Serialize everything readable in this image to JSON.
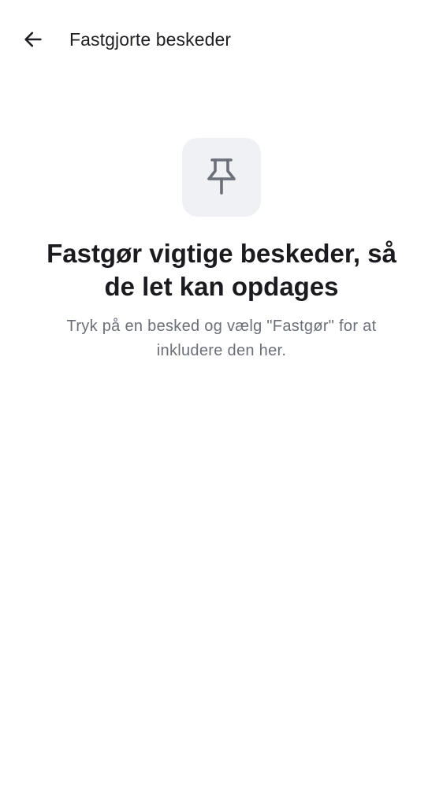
{
  "header": {
    "title": "Fastgjorte beskeder",
    "back_icon": "arrow-left-icon"
  },
  "empty_state": {
    "icon": "pin-icon",
    "heading": "Fastgør vigtige beskeder, så de let kan opdages",
    "body": "Tryk på en besked og vælg \"Fastgør\" for at inkludere den her."
  },
  "colors": {
    "background": "#ffffff",
    "icon_tile": "#f0f1f4",
    "icon": "#6b6f78",
    "text_primary": "#1a1a1f",
    "text_secondary": "#6b6f78"
  }
}
